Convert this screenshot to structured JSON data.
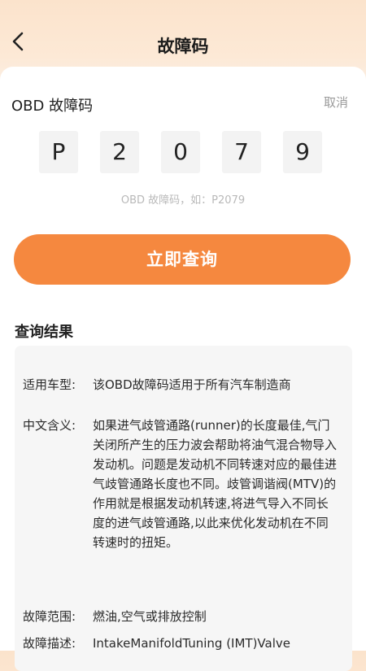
{
  "header": {
    "title": "故障码"
  },
  "form": {
    "label": "OBD 故障码",
    "cancel": "取消",
    "code_chars": [
      "P",
      "2",
      "0",
      "7",
      "9"
    ],
    "hint": "OBD 故障码，如：P2079",
    "submit": "立即查询"
  },
  "results": {
    "title": "查询结果",
    "rows": [
      {
        "label": "适用车型:",
        "value": "该OBD故障码适用于所有汽车制造商"
      },
      {
        "label": "中文含义:",
        "value": "如果进气歧管通路(runner)的长度最佳,气门关闭所产生的压力波会帮助将油气混合物导入发动机。问题是发动机不同转速对应的最佳进气歧管通路长度也不同。歧管调谐阀(MTV)的作用就是根据发动机转速,将进气导入不同长度的进气歧管通路,以此来优化发动机在不同转速时的扭矩。"
      },
      {
        "label": "故障范围:",
        "value": "燃油,空气或排放控制"
      },
      {
        "label": "故障描述:",
        "value": "IntakeManifoldTuning (IMT)Valve"
      }
    ]
  },
  "colors": {
    "accent": "#f5883f",
    "header_bg": "#fbe3cc"
  },
  "icons": {
    "back": "chevron-left-icon"
  }
}
